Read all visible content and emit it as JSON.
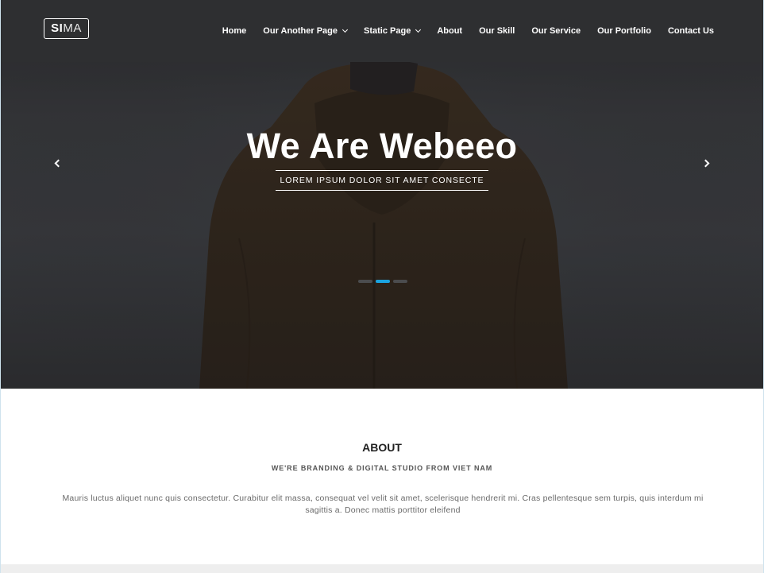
{
  "header": {
    "logo": {
      "strong": "SI",
      "thin": "MA"
    },
    "nav": [
      {
        "label": "Home",
        "dropdown": false
      },
      {
        "label": "Our Another Page",
        "dropdown": true
      },
      {
        "label": "Static Page",
        "dropdown": true
      },
      {
        "label": "About",
        "dropdown": false
      },
      {
        "label": "Our Skill",
        "dropdown": false
      },
      {
        "label": "Our Service",
        "dropdown": false
      },
      {
        "label": "Our Portfolio",
        "dropdown": false
      },
      {
        "label": "Contact Us",
        "dropdown": false
      }
    ]
  },
  "hero": {
    "title": "We Are Webeeo",
    "subtitle": "LOREM IPSUM DOLOR SIT AMET CONSECTE",
    "slides": 3,
    "active_slide": 1
  },
  "about": {
    "title": "ABOUT",
    "subtitle": "WE'RE BRANDING & DIGITAL STUDIO FROM VIET NAM",
    "text": "Mauris luctus aliquet nunc quis consectetur. Curabitur elit massa, consequat vel velit sit amet, scelerisque hendrerit mi. Cras pellentesque sem turpis, quis interdum mi sagittis a. Donec mattis porttitor eleifend"
  },
  "colors": {
    "accent": "#1aa3e0",
    "header_bg": "#2e2f31",
    "footer_strip": "#eeeeee"
  }
}
